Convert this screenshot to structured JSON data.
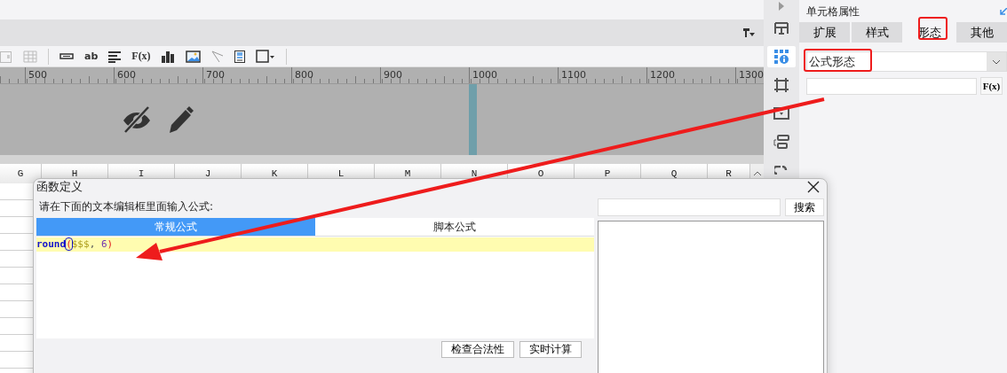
{
  "ruler": {
    "labels": [
      "500",
      "600",
      "700",
      "800",
      "900",
      "1000",
      "1100",
      "1200",
      "1300"
    ]
  },
  "columns": [
    "G",
    "H",
    "I",
    "J",
    "K",
    "L",
    "M",
    "N",
    "O",
    "P",
    "Q",
    "R"
  ],
  "side_icons": [
    {
      "selected": false
    },
    {
      "selected": true
    },
    {
      "selected": false
    },
    {
      "selected": false
    },
    {
      "selected": false
    },
    {
      "selected": false
    }
  ],
  "panel": {
    "title": "单元格属性",
    "tabs": [
      {
        "label": "扩展",
        "selected": false
      },
      {
        "label": "样式",
        "selected": false
      },
      {
        "label": "形态",
        "selected": true
      },
      {
        "label": "其他",
        "selected": false
      }
    ],
    "dropdown": {
      "value": "公式形态"
    },
    "formula_field": {
      "button": "F(x)"
    }
  },
  "dialog": {
    "title": "函数定义",
    "prompt": "请在下面的文本编辑框里面输入公式:",
    "tabs": [
      {
        "label": "常规公式",
        "selected": true
      },
      {
        "label": "脚本公式",
        "selected": false
      }
    ],
    "code": [
      {
        "kind": "function",
        "text": "round"
      },
      {
        "kind": "bracket",
        "text": "("
      },
      {
        "kind": "variable",
        "text": "$$$"
      },
      {
        "kind": "punct",
        "text": ", "
      },
      {
        "kind": "number",
        "text": "6"
      },
      {
        "kind": "bracket",
        "text": ")"
      }
    ],
    "search_button": "搜索",
    "buttons": [
      "检查合法性",
      "实时计算"
    ]
  },
  "toolbar": {
    "formula_button": "F(x)",
    "text_button": "ab"
  }
}
